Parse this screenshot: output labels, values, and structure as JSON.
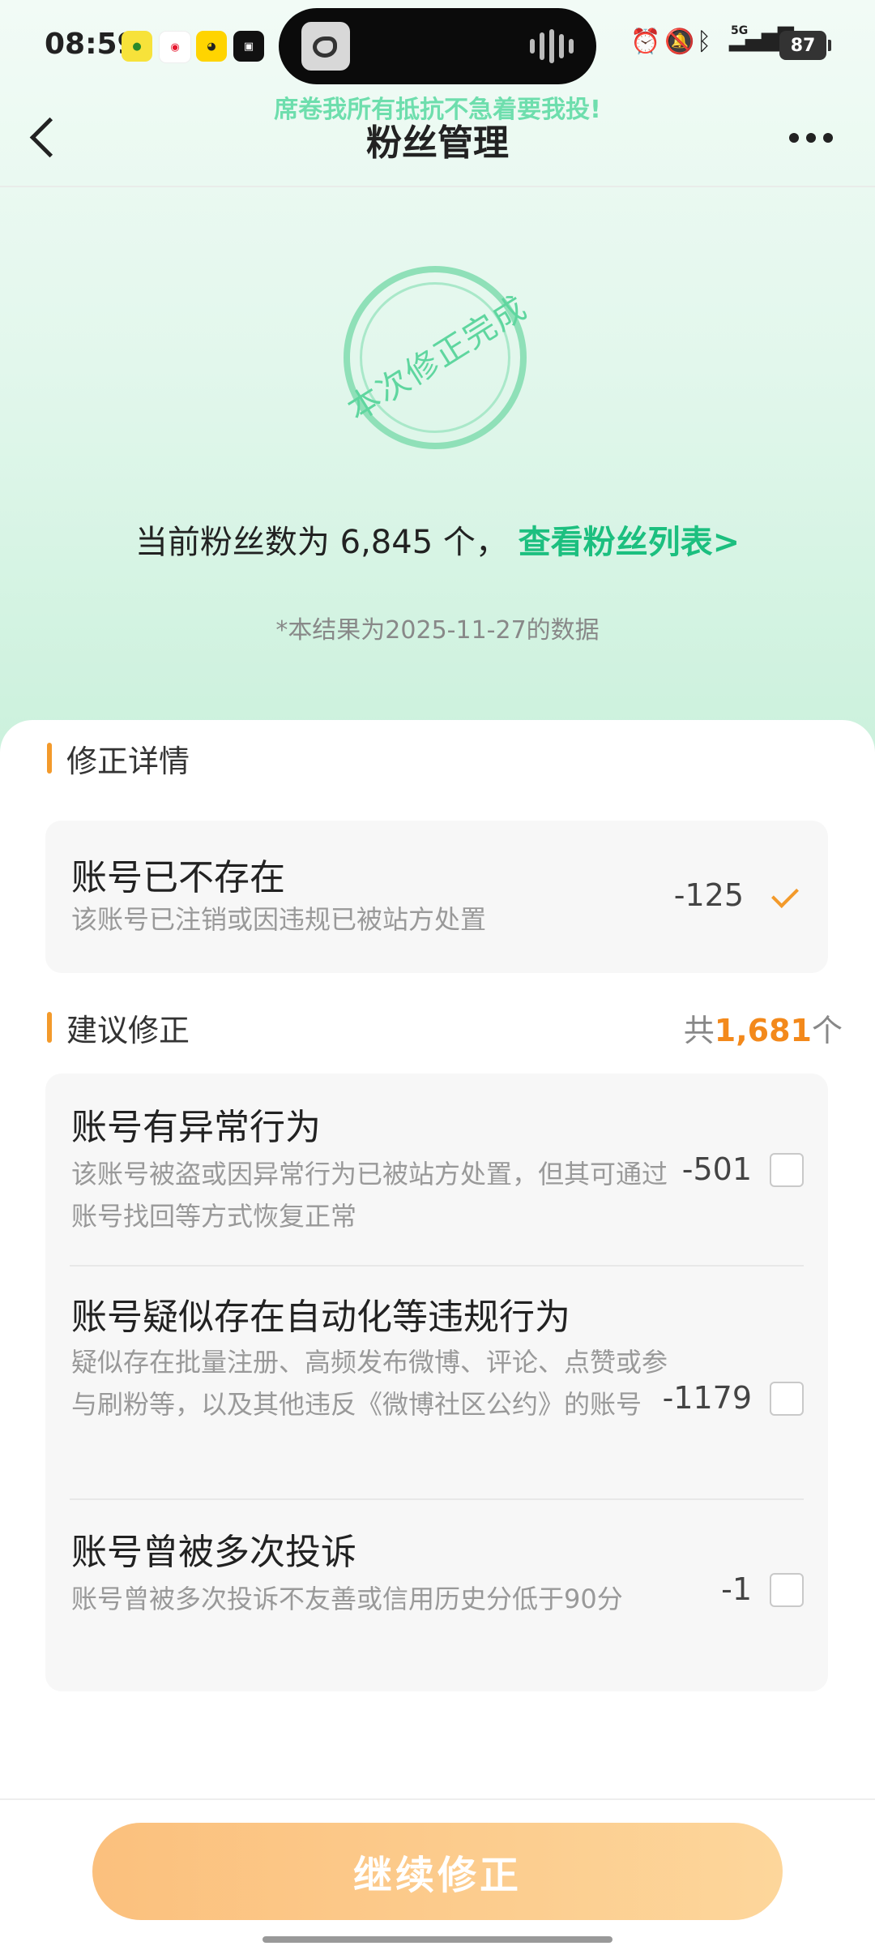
{
  "status_bar": {
    "time": "08:59",
    "battery": "87",
    "network": "5G"
  },
  "nav": {
    "title": "粉丝管理",
    "marquee": "席卷我所有抵抗不急着要我投!"
  },
  "hero": {
    "stamp_text": "本次修正完成",
    "fans_prefix": "当前粉丝数为",
    "fans_count": "6,845",
    "fans_unit": "个，",
    "view_list_link": "查看粉丝列表>",
    "data_note": "*本结果为2025-11-27的数据"
  },
  "corrected_section": {
    "title": "修正详情",
    "items": [
      {
        "title": "账号已不存在",
        "description": "该账号已注销或因违规已被站方处置",
        "value": "-125",
        "done": true
      }
    ]
  },
  "suggested_section": {
    "title": "建议修正",
    "total_prefix": "共",
    "total_count": "1,681",
    "total_unit": "个",
    "items": [
      {
        "title": "账号有异常行为",
        "description": "该账号被盗或因异常行为已被站方处置，但其可通过账号找回等方式恢复正常",
        "value": "-501",
        "checked": false
      },
      {
        "title": "账号疑似存在自动化等违规行为",
        "description": "疑似存在批量注册、高频发布微博、评论、点赞或参与刷粉等，以及其他违反《微博社区公约》的账号",
        "value": "-1179",
        "checked": false
      },
      {
        "title": "账号曾被多次投诉",
        "description": "账号曾被多次投诉不友善或信用历史分低于90分",
        "value": "-1",
        "checked": false
      }
    ]
  },
  "footer": {
    "button_label": "继续修正"
  },
  "colors": {
    "accent_green": "#1cbf7f",
    "accent_orange": "#f3891b",
    "button_gradient_start": "#fbc07d",
    "button_gradient_end": "#fdd69b"
  }
}
